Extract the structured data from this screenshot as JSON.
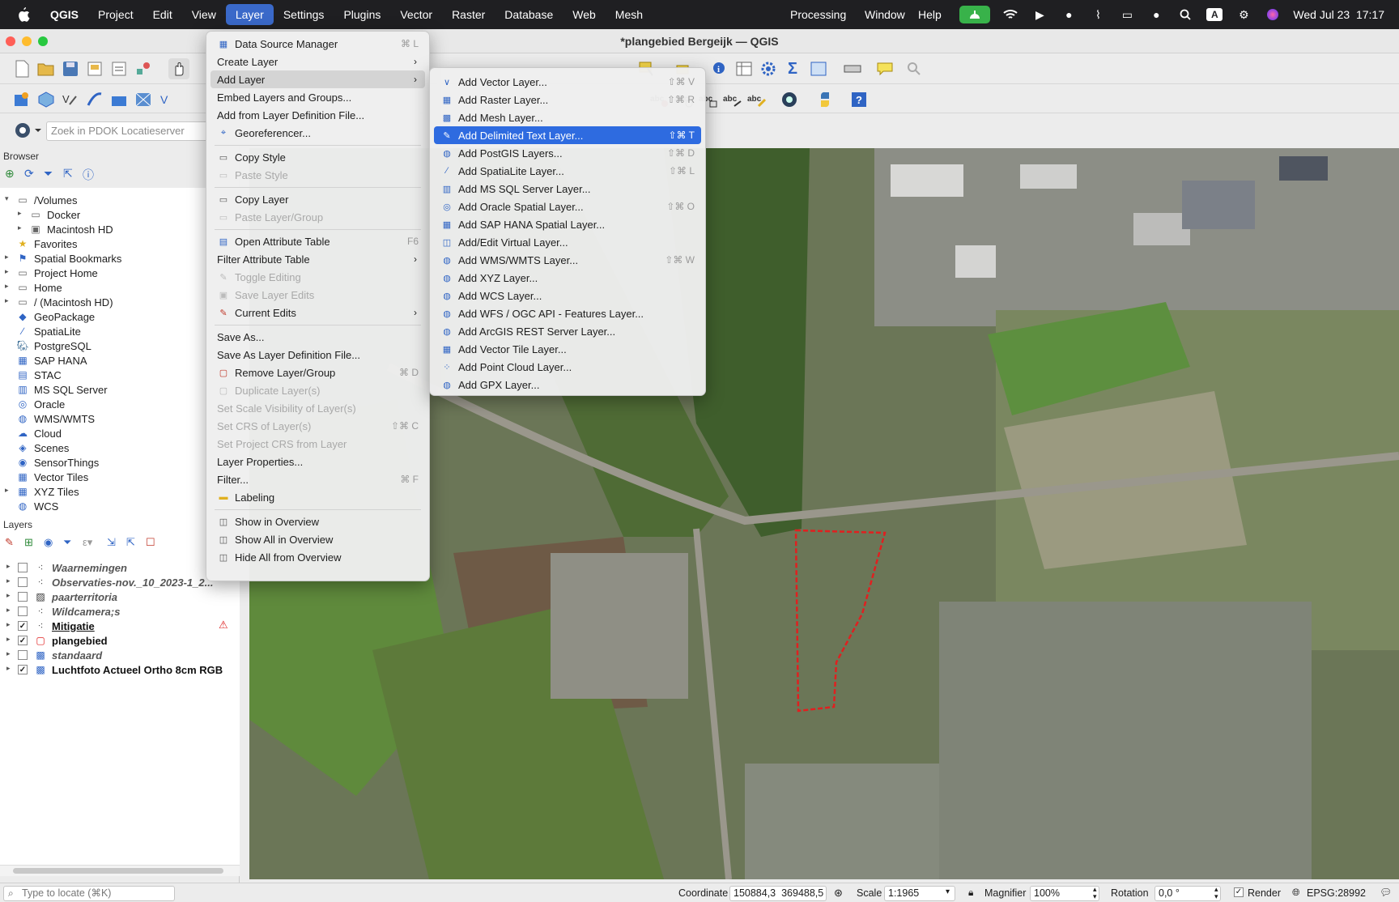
{
  "menubar": {
    "app": "QGIS",
    "items": [
      "Project",
      "Edit",
      "View",
      "Layer",
      "Settings",
      "Plugins",
      "Vector",
      "Raster",
      "Database",
      "Web",
      "Mesh",
      "Processing",
      "Window",
      "Help"
    ],
    "active": "Layer",
    "clock": "Wed Jul 23  17:17"
  },
  "window": {
    "title": "*plangebied Bergeijk — QGIS"
  },
  "locator_search": {
    "placeholder": "Zoek in PDOK Locatieserver"
  },
  "browser": {
    "title": "Browser",
    "items": [
      {
        "label": "/Volumes",
        "icon": "folder-icon"
      },
      {
        "label": "Docker",
        "icon": "folder-icon"
      },
      {
        "label": "Macintosh HD",
        "icon": "drive-icon"
      },
      {
        "label": "Favorites",
        "icon": "star-icon"
      },
      {
        "label": "Spatial Bookmarks",
        "icon": "bookmark-icon"
      },
      {
        "label": "Project Home",
        "icon": "folder-icon"
      },
      {
        "label": "Home",
        "icon": "folder-icon"
      },
      {
        "label": "/ (Macintosh HD)",
        "icon": "folder-icon"
      },
      {
        "label": "GeoPackage",
        "icon": "geopackage-icon"
      },
      {
        "label": "SpatiaLite",
        "icon": "spatialite-icon"
      },
      {
        "label": "PostgreSQL",
        "icon": "postgresql-icon"
      },
      {
        "label": "SAP HANA",
        "icon": "hana-icon"
      },
      {
        "label": "STAC",
        "icon": "stac-icon"
      },
      {
        "label": "MS SQL Server",
        "icon": "mssql-icon"
      },
      {
        "label": "Oracle",
        "icon": "oracle-icon"
      },
      {
        "label": "WMS/WMTS",
        "icon": "globe-icon"
      },
      {
        "label": "Cloud",
        "icon": "cloud-icon"
      },
      {
        "label": "Scenes",
        "icon": "scenes-icon"
      },
      {
        "label": "SensorThings",
        "icon": "sensor-icon"
      },
      {
        "label": "Vector Tiles",
        "icon": "grid-icon"
      },
      {
        "label": "XYZ Tiles",
        "icon": "grid-icon"
      },
      {
        "label": "WCS",
        "icon": "globe-icon"
      }
    ]
  },
  "layers": {
    "title": "Layers",
    "items": [
      {
        "label": "Waarnemingen",
        "checked": false
      },
      {
        "label": "Observaties-nov._10_2023-1_2...",
        "checked": false
      },
      {
        "label": "paarterritoria",
        "checked": false
      },
      {
        "label": "Wildcamera;s",
        "checked": false
      },
      {
        "label": "Mitigatie",
        "checked": true
      },
      {
        "label": "plangebied",
        "checked": true
      },
      {
        "label": "standaard",
        "checked": false
      },
      {
        "label": "Luchtfoto Actueel Ortho 8cm RGB",
        "checked": true
      }
    ]
  },
  "layer_menu": {
    "items": [
      {
        "label": "Data Source Manager",
        "shortcut": "⌘ L",
        "icon": "datasource-icon"
      },
      {
        "label": "Create Layer",
        "submenu": true
      },
      {
        "label": "Add Layer",
        "submenu": true
      },
      {
        "label": "Embed Layers and Groups..."
      },
      {
        "label": "Add from Layer Definition File..."
      },
      {
        "label": "Georeferencer...",
        "icon": "georeferencer-icon"
      },
      {
        "label": "Copy Style",
        "icon": "copy-style-icon"
      },
      {
        "label": "Paste Style",
        "icon": "paste-style-icon"
      },
      {
        "label": "Copy Layer",
        "icon": "copy-layer-icon"
      },
      {
        "label": "Paste Layer/Group",
        "icon": "paste-layer-icon"
      },
      {
        "label": "Open Attribute Table",
        "shortcut": "F6",
        "icon": "table-icon"
      },
      {
        "label": "Filter Attribute Table",
        "submenu": true
      },
      {
        "label": "Toggle Editing",
        "icon": "pencil-icon"
      },
      {
        "label": "Save Layer Edits",
        "icon": "save-edits-icon"
      },
      {
        "label": "Current Edits",
        "submenu": true,
        "icon": "edits-icon"
      },
      {
        "label": "Save As..."
      },
      {
        "label": "Save As Layer Definition File..."
      },
      {
        "label": "Remove Layer/Group",
        "shortcut": "⌘ D",
        "icon": "remove-icon"
      },
      {
        "label": "Duplicate Layer(s)",
        "icon": "duplicate-icon"
      },
      {
        "label": "Set Scale Visibility of Layer(s)"
      },
      {
        "label": "Set CRS of Layer(s)",
        "shortcut": "⇧⌘ C"
      },
      {
        "label": "Set Project CRS from Layer"
      },
      {
        "label": "Layer Properties..."
      },
      {
        "label": "Filter...",
        "shortcut": "⌘ F"
      },
      {
        "label": "Labeling",
        "icon": "label-icon"
      },
      {
        "label": "Show in Overview",
        "icon": "overview-icon"
      },
      {
        "label": "Show All in Overview",
        "icon": "overview-all-icon"
      },
      {
        "label": "Hide All from Overview",
        "icon": "overview-hide-icon"
      }
    ]
  },
  "add_layer_menu": {
    "items": [
      {
        "label": "Add Vector Layer...",
        "shortcut": "⇧⌘ V",
        "icon": "vector-layer-icon"
      },
      {
        "label": "Add Raster Layer...",
        "shortcut": "⇧⌘ R",
        "icon": "raster-layer-icon"
      },
      {
        "label": "Add Mesh Layer...",
        "icon": "mesh-layer-icon"
      },
      {
        "label": "Add Delimited Text Layer...",
        "shortcut": "⇧⌘ T",
        "icon": "delimited-text-icon"
      },
      {
        "label": "Add PostGIS Layers...",
        "shortcut": "⇧⌘ D",
        "icon": "postgis-icon"
      },
      {
        "label": "Add SpatiaLite Layer...",
        "shortcut": "⇧⌘ L",
        "icon": "spatialite-icon"
      },
      {
        "label": "Add MS SQL Server Layer...",
        "icon": "mssql-icon"
      },
      {
        "label": "Add Oracle Spatial Layer...",
        "shortcut": "⇧⌘ O",
        "icon": "oracle-icon"
      },
      {
        "label": "Add SAP HANA Spatial Layer...",
        "icon": "hana-icon"
      },
      {
        "label": "Add/Edit Virtual Layer...",
        "icon": "virtual-layer-icon"
      },
      {
        "label": "Add WMS/WMTS Layer...",
        "shortcut": "⇧⌘ W",
        "icon": "wms-icon"
      },
      {
        "label": "Add XYZ Layer...",
        "icon": "xyz-icon"
      },
      {
        "label": "Add WCS Layer...",
        "icon": "wcs-icon"
      },
      {
        "label": "Add WFS / OGC API - Features Layer...",
        "icon": "wfs-icon"
      },
      {
        "label": "Add ArcGIS REST Server Layer...",
        "icon": "arcgis-icon"
      },
      {
        "label": "Add Vector Tile Layer...",
        "icon": "vector-tile-icon"
      },
      {
        "label": "Add Point Cloud Layer...",
        "icon": "point-cloud-icon"
      },
      {
        "label": "Add GPX Layer...",
        "icon": "gpx-icon"
      }
    ]
  },
  "statusbar": {
    "locate_placeholder": "Type to locate (⌘K)",
    "coordinate_label": "Coordinate",
    "coordinate_value": "150884,3  369488,5",
    "scale_label": "Scale",
    "scale_value": "1:1965",
    "magnifier_label": "Magnifier",
    "magnifier_value": "100%",
    "rotation_label": "Rotation",
    "rotation_value": "0,0 °",
    "render_label": "Render",
    "crs": "EPSG:28992"
  },
  "colors": {
    "accent": "#2e6be0",
    "plangebied_outline": "#e02020",
    "menubar_bg": "#1f1f22"
  }
}
